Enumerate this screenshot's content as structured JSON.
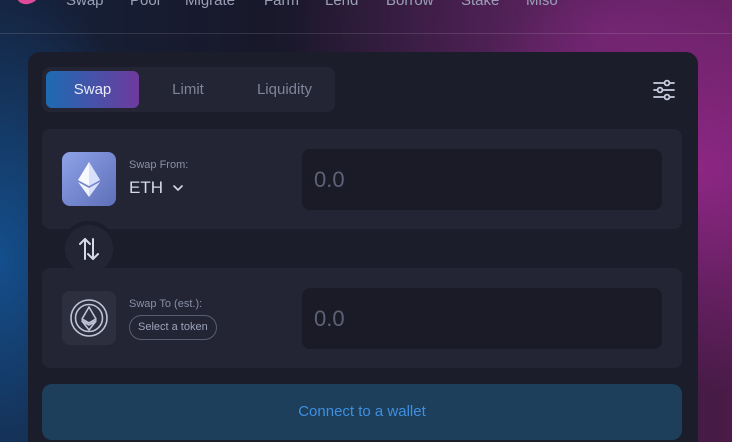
{
  "nav": {
    "items": [
      "Swap",
      "Pool",
      "Migrate",
      "Farm",
      "Lend",
      "Borrow",
      "Stake",
      "Miso"
    ]
  },
  "tabs": [
    {
      "label": "Swap",
      "active": true
    },
    {
      "label": "Limit",
      "active": false
    },
    {
      "label": "Liquidity",
      "active": false
    }
  ],
  "settings_icon": "sliders-icon",
  "swap_from": {
    "label": "Swap From:",
    "token": "ETH",
    "token_icon": "ethereum-icon",
    "amount_placeholder": "0.0"
  },
  "swap_to": {
    "label": "Swap To (est.):",
    "select_token_label": "Select a token",
    "token_icon": "ethereum-outline-icon",
    "amount_placeholder": "0.0"
  },
  "switch_icon": "swap-arrows-icon",
  "connect_button": "Connect to a wallet",
  "colors": {
    "accent_blue": "#1d6bb3",
    "accent_purple": "#6e3a9e",
    "connect_text": "#3e8fe0",
    "connect_bg": "#1d3f5c"
  }
}
